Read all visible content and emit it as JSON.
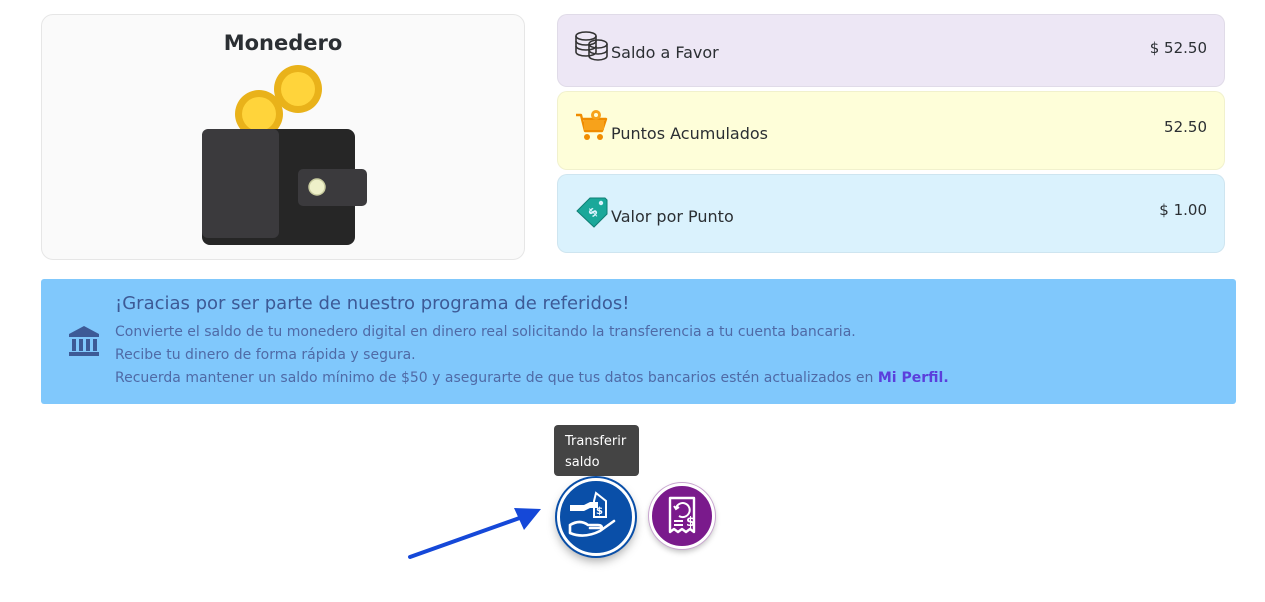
{
  "wallet": {
    "title": "Monedero",
    "illustration": "wallet-with-coins-illustration"
  },
  "stats": {
    "favor": {
      "label": "Saldo a Favor",
      "value": "$ 52.50",
      "icon": "coins-stack-icon",
      "bg": "#ede7f5"
    },
    "puntos": {
      "label": "Puntos Acumulados",
      "value": "52.50",
      "icon": "cart-gear-icon",
      "bg": "#fefed9"
    },
    "valor": {
      "label": "Valor por Punto",
      "value": "$ 1.00",
      "icon": "price-tag-icon",
      "bg": "#daf2fd"
    }
  },
  "banner": {
    "icon": "bank-icon",
    "title": "¡Gracias por ser parte de nuestro programa de referidos!",
    "line1": "Convierte el saldo de tu monedero digital en dinero real solicitando la transferencia a tu cuenta bancaria.",
    "line2": "Recibe tu dinero de forma rápida y segura.",
    "line3": "Recuerda mantener un saldo mínimo de $50 y asegurarte de que tus datos bancarios estén actualizados en",
    "profile_link": "Mi Perfil.",
    "bg": "#80c8fc"
  },
  "actions": {
    "tooltip_line1": "Transferir",
    "tooltip_line2": "saldo",
    "transfer_icon": "hand-money-transfer-icon",
    "history_icon": "receipt-refund-icon",
    "transfer_color": "#0a4fa8",
    "history_color": "#7a1a8c"
  },
  "annotation": {
    "arrow_color": "#1548d8",
    "icon": "pointer-arrow-icon"
  }
}
